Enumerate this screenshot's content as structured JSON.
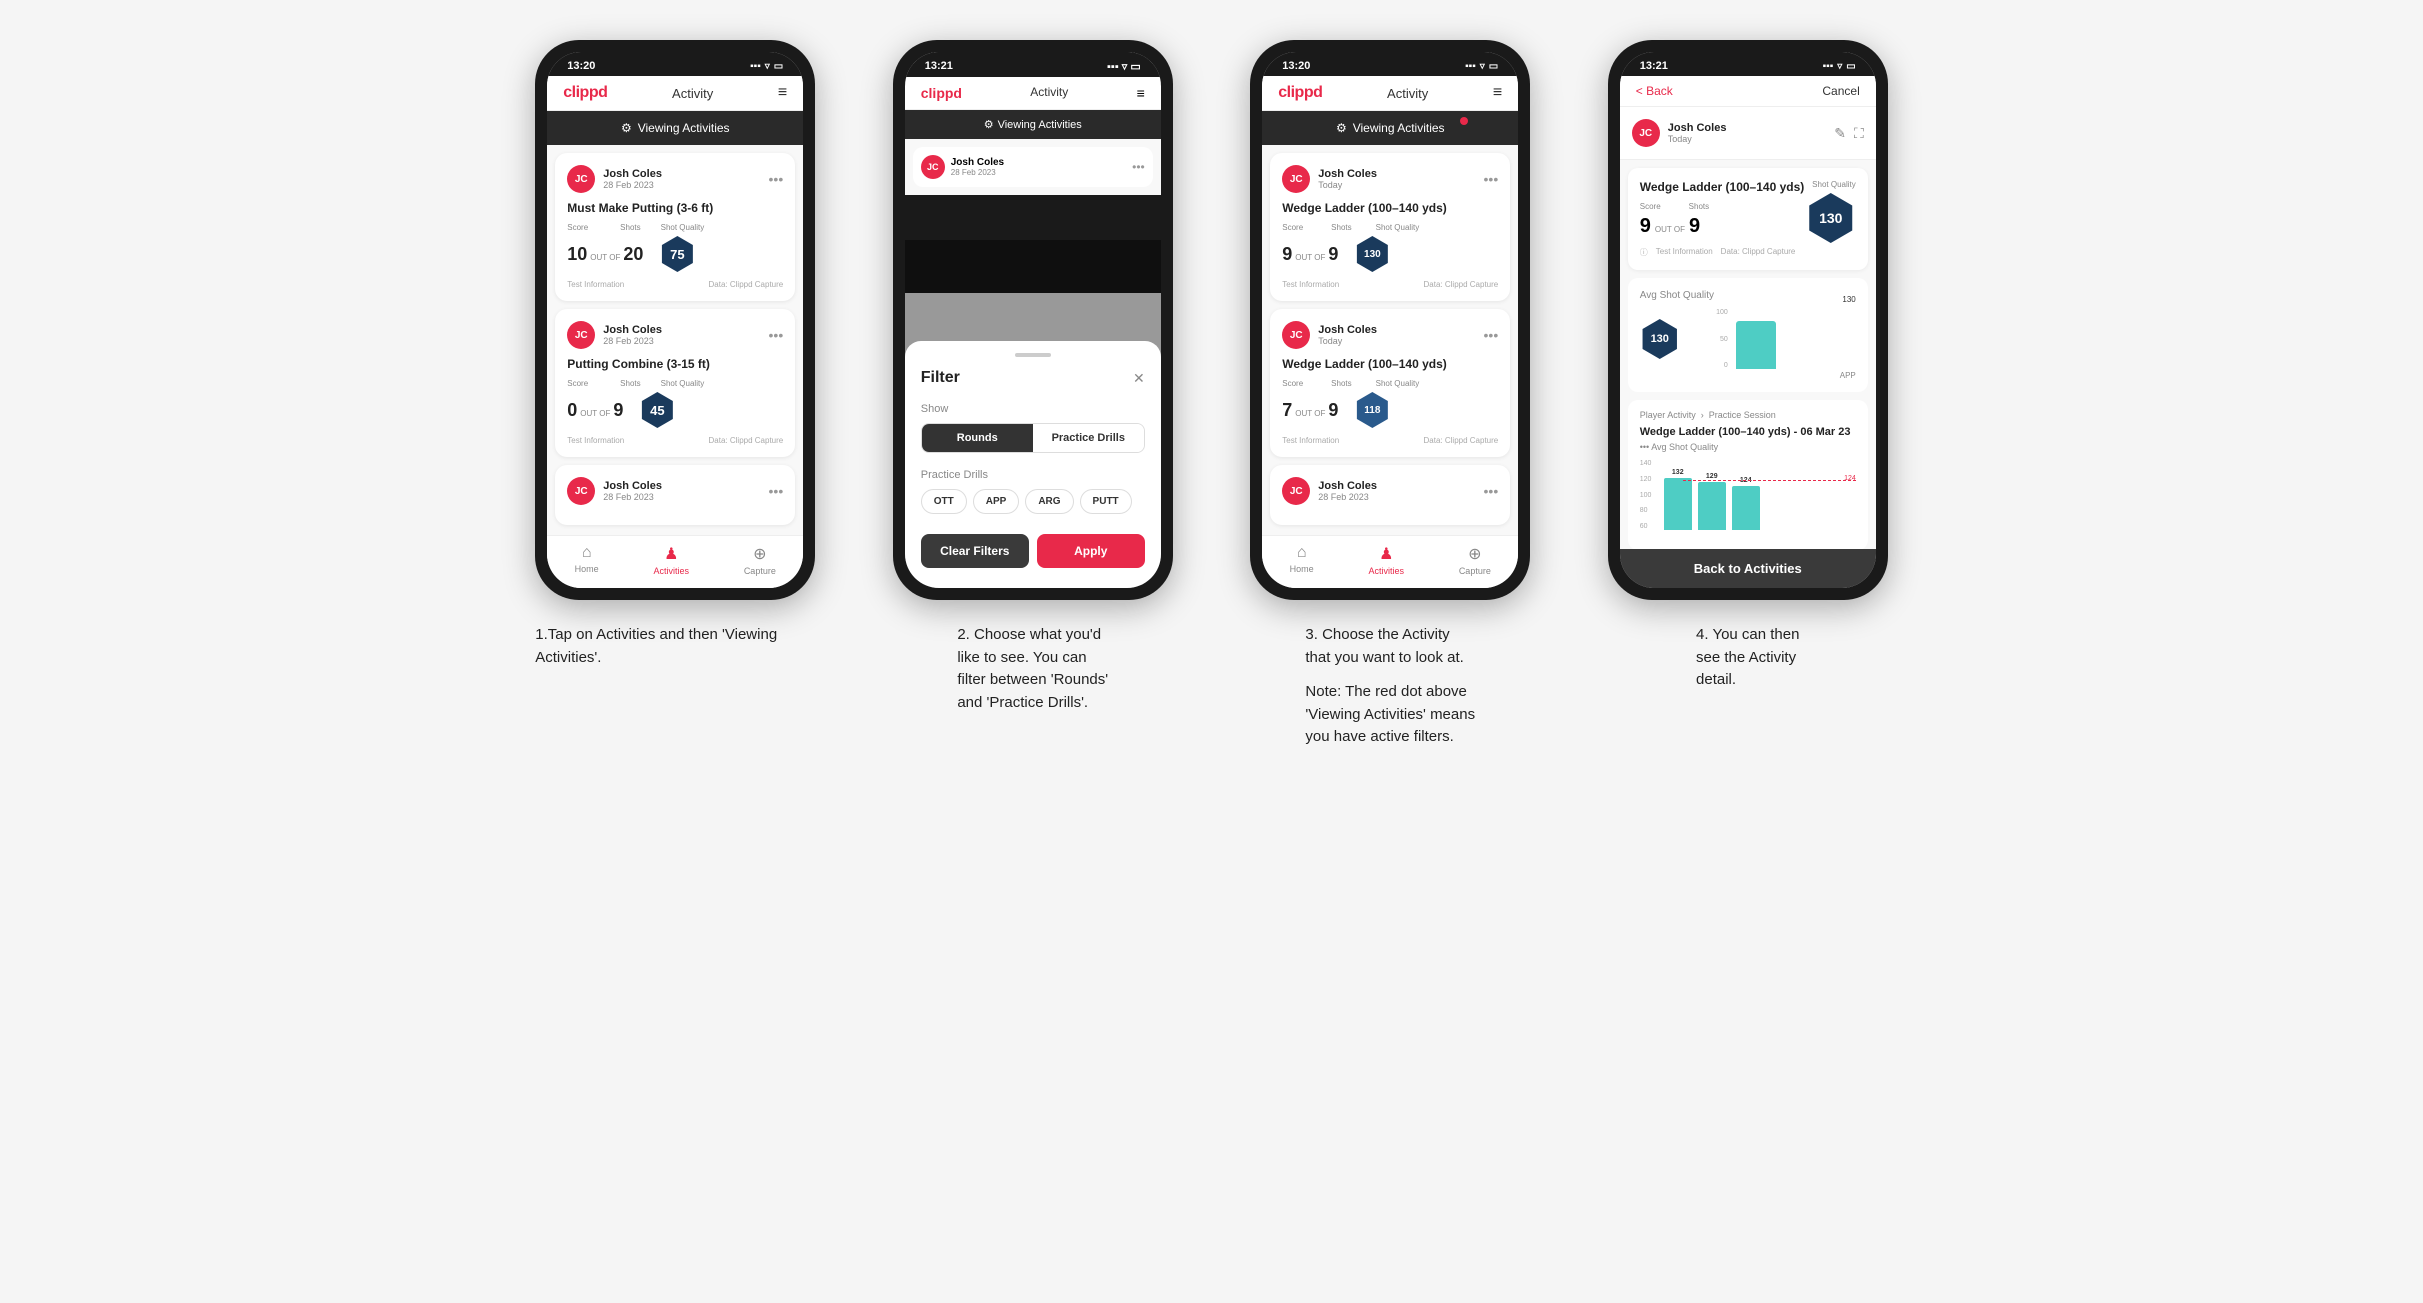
{
  "page": {
    "background": "#f5f5f5"
  },
  "steps": [
    {
      "id": 1,
      "description": "1.Tap on Activities and then 'Viewing Activities'."
    },
    {
      "id": 2,
      "description_line1": "2. Choose what you'd",
      "description_line2": "like to see. You can",
      "description_line3": "filter between 'Rounds'",
      "description_line4": "and 'Practice Drills'."
    },
    {
      "id": 3,
      "description_line1": "3. Choose the Activity",
      "description_line2": "that you want to look at.",
      "note_line1": "Note: The red dot above",
      "note_line2": "'Viewing Activities' means",
      "note_line3": "you have active filters."
    },
    {
      "id": 4,
      "description_line1": "4. You can then",
      "description_line2": "see the Activity",
      "description_line3": "detail."
    }
  ],
  "phone1": {
    "status_time": "13:20",
    "nav_logo": "clippd",
    "nav_title": "Activity",
    "banner_text": "Viewing Activities",
    "cards": [
      {
        "user_name": "Josh Coles",
        "user_date": "28 Feb 2023",
        "title": "Must Make Putting (3-6 ft)",
        "score_label": "Score",
        "shots_label": "Shots",
        "shot_quality_label": "Shot Quality",
        "score": "10",
        "shots": "20",
        "shot_quality": "75",
        "footer_left": "Test Information",
        "footer_right": "Data: Clippd Capture"
      },
      {
        "user_name": "Josh Coles",
        "user_date": "28 Feb 2023",
        "title": "Putting Combine (3-15 ft)",
        "score": "0",
        "shots": "9",
        "shot_quality": "45",
        "footer_left": "Test Information",
        "footer_right": "Data: Clippd Capture"
      },
      {
        "user_name": "Josh Coles",
        "user_date": "28 Feb 2023",
        "title": "..."
      }
    ],
    "tabs": [
      "Home",
      "Activities",
      "Capture"
    ]
  },
  "phone2": {
    "status_time": "13:21",
    "nav_logo": "clippd",
    "nav_title": "Activity",
    "banner_text": "Viewing Activities",
    "filter": {
      "title": "Filter",
      "show_label": "Show",
      "rounds_btn": "Rounds",
      "practice_btn": "Practice Drills",
      "practice_drills_label": "Practice Drills",
      "chips": [
        "OTT",
        "APP",
        "ARG",
        "PUTT"
      ],
      "clear_btn": "Clear Filters",
      "apply_btn": "Apply"
    }
  },
  "phone3": {
    "status_time": "13:20",
    "nav_logo": "clippd",
    "nav_title": "Activity",
    "banner_text": "Viewing Activities",
    "has_red_dot": true,
    "cards": [
      {
        "user_name": "Josh Coles",
        "user_date": "Today",
        "title": "Wedge Ladder (100–140 yds)",
        "score_label": "Score",
        "shots_label": "Shots",
        "shot_quality_label": "Shot Quality",
        "score": "9",
        "shots": "9",
        "shot_quality": "130",
        "footer_left": "Test Information",
        "footer_right": "Data: Clippd Capture"
      },
      {
        "user_name": "Josh Coles",
        "user_date": "Today",
        "title": "Wedge Ladder (100–140 yds)",
        "score": "7",
        "shots": "9",
        "shot_quality": "118",
        "footer_left": "Test Information",
        "footer_right": "Data: Clippd Capture"
      },
      {
        "user_name": "Josh Coles",
        "user_date": "28 Feb 2023",
        "title": "..."
      }
    ],
    "tabs": [
      "Home",
      "Activities",
      "Capture"
    ]
  },
  "phone4": {
    "status_time": "13:21",
    "back_label": "< Back",
    "cancel_label": "Cancel",
    "user_name": "Josh Coles",
    "user_date": "Today",
    "drill_title": "Wedge Ladder (100–140 yds)",
    "score_label": "Score",
    "shots_label": "Shots",
    "score": "9",
    "shots": "9",
    "out_of": "OUT OF",
    "shot_quality": "130",
    "info_left": "Test Information",
    "info_right": "Data: Clippd Capture",
    "avg_shot_quality_label": "Avg Shot Quality",
    "chart_value": "130",
    "chart_y_labels": [
      "100",
      "50",
      "0"
    ],
    "chart_x_label": "APP",
    "player_activity_label": "Player Activity",
    "practice_session_label": "Practice Session",
    "drill_detail_title": "Wedge Ladder (100–140 yds) - 06 Mar 23",
    "drill_detail_subtitle": "••• Avg Shot Quality",
    "bar_values": [
      "132",
      "129",
      "124"
    ],
    "back_to_activities": "Back to Activities"
  }
}
